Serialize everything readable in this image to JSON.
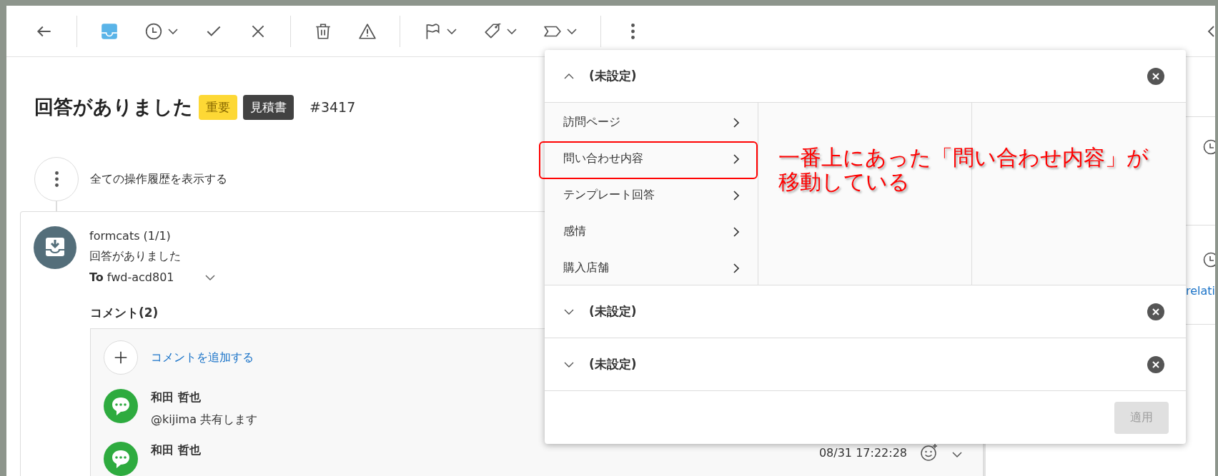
{
  "toolbar": {
    "groups": [
      [
        {
          "kind": "back",
          "dropdown": false,
          "selected": false
        }
      ],
      [
        {
          "kind": "inbox",
          "dropdown": false,
          "selected": true
        },
        {
          "kind": "snooze",
          "dropdown": true,
          "selected": false
        },
        {
          "kind": "done",
          "dropdown": false,
          "selected": false
        },
        {
          "kind": "close",
          "dropdown": false,
          "selected": false
        }
      ],
      [
        {
          "kind": "trash",
          "dropdown": false,
          "selected": false
        },
        {
          "kind": "spam",
          "dropdown": false,
          "selected": false
        }
      ],
      [
        {
          "kind": "flag",
          "dropdown": true,
          "selected": false
        },
        {
          "kind": "tag",
          "dropdown": true,
          "selected": false
        },
        {
          "kind": "label",
          "dropdown": true,
          "selected": false
        }
      ],
      [
        {
          "kind": "more",
          "dropdown": false,
          "selected": false
        }
      ]
    ]
  },
  "ticket": {
    "title": "回答がありました",
    "tags": [
      {
        "label": "重要",
        "color": "#fdd835"
      },
      {
        "label": "見積書",
        "color": "#424242"
      }
    ],
    "number": "#3417"
  },
  "history_link": "全ての操作履歴を表示する",
  "message": {
    "sender": "formcats (1/1)",
    "subject": "回答がありました",
    "recipient": "**To** fwd-acd801",
    "comments_heading": "コメント(2)",
    "add_comment": "コメントを追加する",
    "comments": [
      {
        "author": "和田 哲也",
        "text": "@kijima 共有します"
      },
      {
        "author": "和田 哲也",
        "time": "08/31 17:22:28"
      }
    ]
  },
  "right_panel": {
    "link": "relati"
  },
  "filter_popup": {
    "sections": [
      {
        "title": "(未設定)",
        "expanded": true,
        "items": [
          {
            "label": "訪問ページ",
            "highlighted": false
          },
          {
            "label": "問い合わせ内容",
            "highlighted": true
          },
          {
            "label": "テンプレート回答",
            "highlighted": false
          },
          {
            "label": "感情",
            "highlighted": false
          },
          {
            "label": "購入店舗",
            "highlighted": false
          }
        ]
      },
      {
        "title": "(未設定)",
        "expanded": false
      },
      {
        "title": "(未設定)",
        "expanded": false
      }
    ],
    "apply_button": {
      "label": "適用",
      "disabled": true
    }
  },
  "annotation": {
    "lines": [
      "一番上にあった「問い合わせ内容」が",
      "移動している"
    ]
  }
}
